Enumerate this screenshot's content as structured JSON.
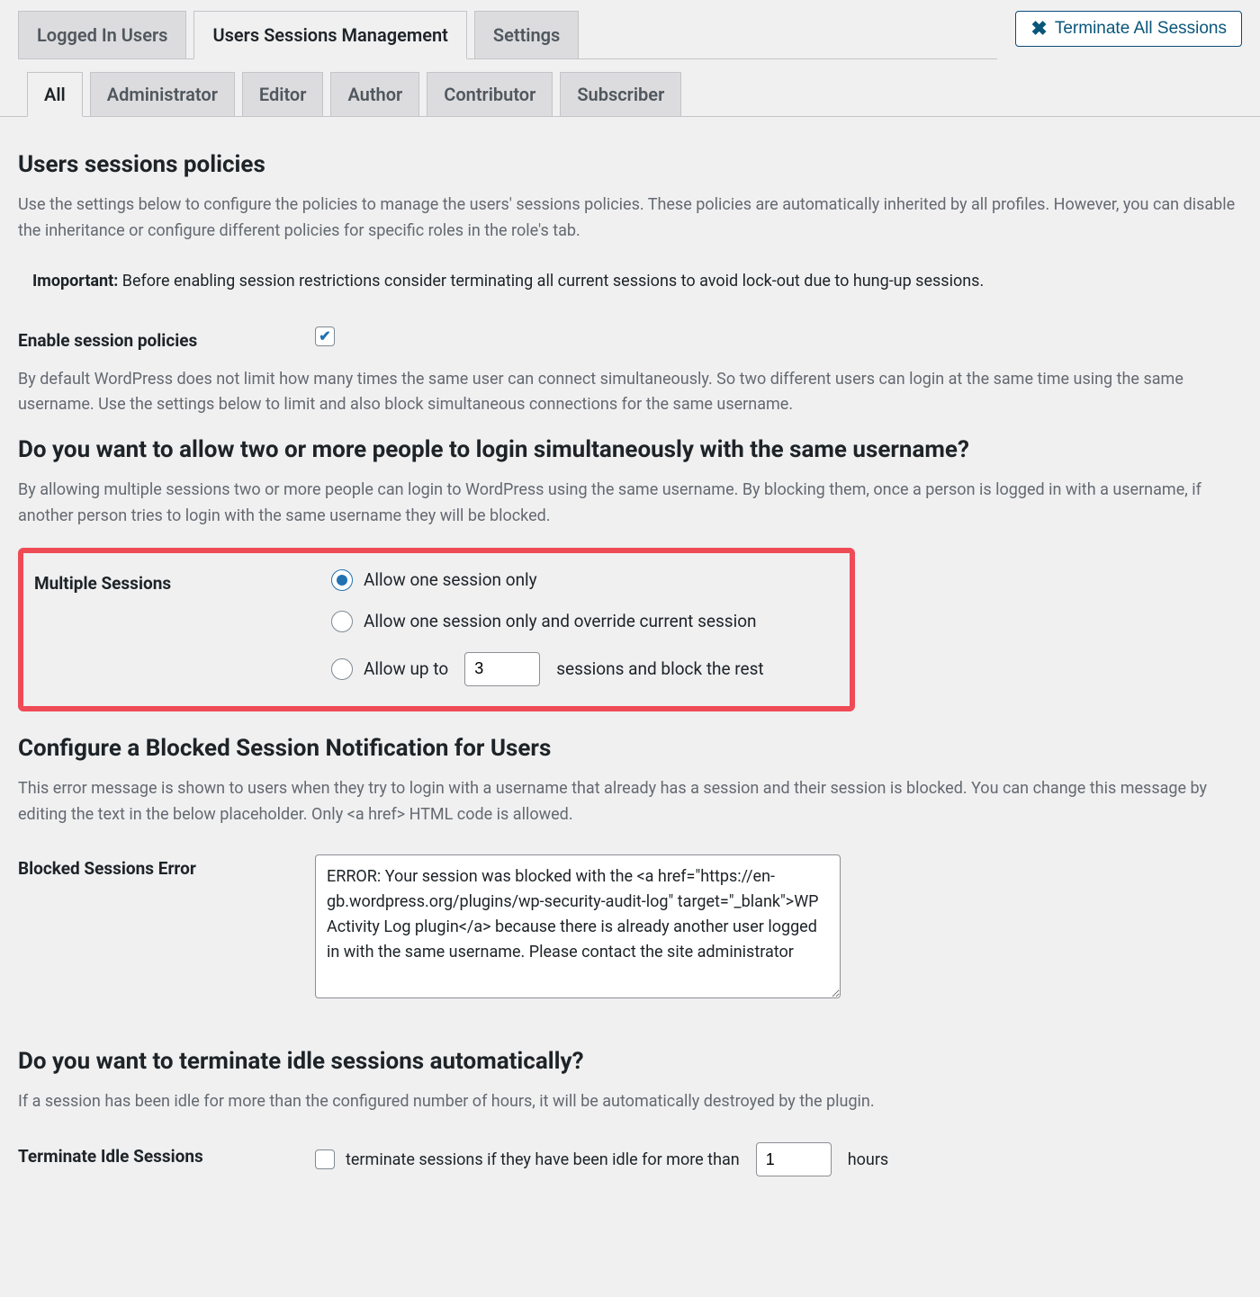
{
  "header": {
    "tabs": {
      "logged_in_users": "Logged In Users",
      "users_sessions_management": "Users Sessions Management",
      "settings": "Settings"
    },
    "terminate_all": "Terminate All Sessions"
  },
  "sub_tabs": {
    "all": "All",
    "administrator": "Administrator",
    "editor": "Editor",
    "author": "Author",
    "contributor": "Contributor",
    "subscriber": "Subscriber"
  },
  "sections": {
    "policies_heading": "Users sessions policies",
    "policies_desc": "Use the settings below to configure the policies to manage the users' sessions policies. These policies are automatically inherited by all profiles. However, you can disable the inheritance or configure different policies for specific roles in the role's tab.",
    "important_label": "Imoportant:",
    "important_text": " Before enabling session restrictions consider terminating all current sessions to avoid lock-out due to hung-up sessions.",
    "enable_label": "Enable session policies",
    "by_default_text": "By default WordPress does not limit how many times the same user can connect simultaneously. So two different users can login at the same time using the same username. Use the settings below to limit and also block simultaneous connections for the same username.",
    "multi_heading": "Do you want to allow two or more people to login simultaneously with the same username?",
    "multi_desc": "By allowing multiple sessions two or more people can login to WordPress using the same username. By blocking them, once a person is logged in with a username, if another person tries to login with the same username they will be blocked.",
    "multi_label": "Multiple Sessions",
    "radio1": "Allow one session only",
    "radio2": "Allow one session only and override current session",
    "radio3_pre": "Allow up to",
    "radio3_post": " sessions and block the rest",
    "radio3_value": "3",
    "blocked_heading": "Configure a Blocked Session Notification for Users",
    "blocked_desc": "This error message is shown to users when they try to login with a username that already has a session and their session is blocked. You can change this message by editing the text in the below placeholder. Only <a href> HTML code is allowed.",
    "blocked_label": "Blocked Sessions Error",
    "blocked_value": "ERROR: Your session was blocked with the <a href=\"https://en-gb.wordpress.org/plugins/wp-security-audit-log\" target=\"_blank\">WP Activity Log plugin</a> because there is already another user logged in with the same username. Please contact the site administrator",
    "terminate_heading": "Do you want to terminate idle sessions automatically?",
    "terminate_desc": "If a session has been idle for more than the configured number of hours, it will be automatically destroyed by the plugin.",
    "terminate_label": "Terminate Idle Sessions",
    "terminate_check_text": "terminate sessions if they have been idle for more than",
    "terminate_hours_value": "1",
    "terminate_hours_suffix": "hours"
  }
}
